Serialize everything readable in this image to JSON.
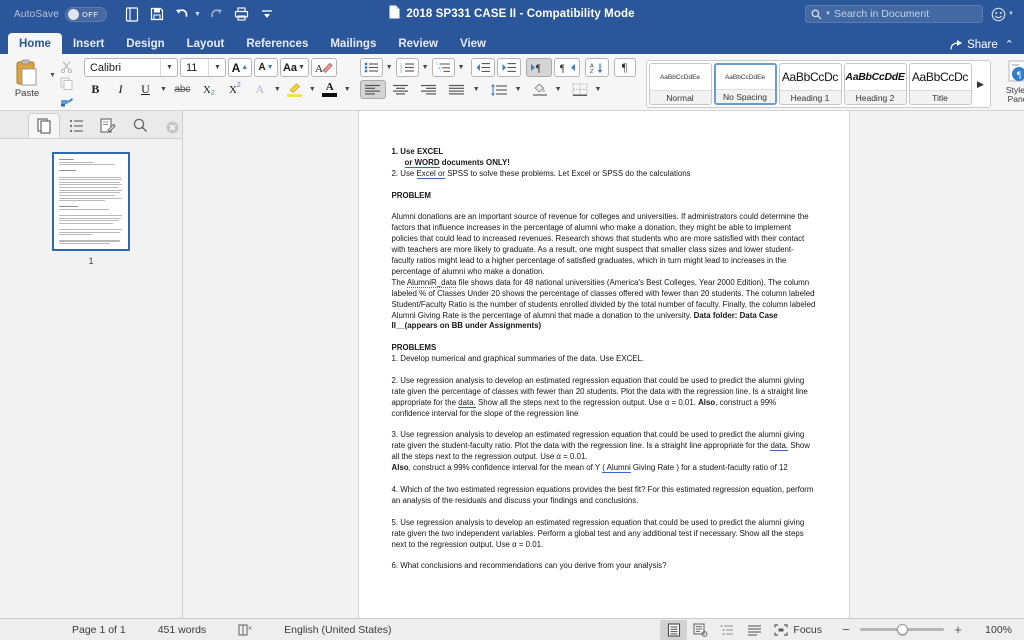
{
  "titlebar": {
    "autosave_label": "AutoSave",
    "autosave_state": "OFF",
    "document_title": "2018 SP331 CASE II  -  Compatibility Mode",
    "quick_access": [
      {
        "name": "new-document-icon",
        "label": "New"
      },
      {
        "name": "save-icon",
        "label": "Save"
      },
      {
        "name": "undo-icon",
        "label": "Undo"
      },
      {
        "name": "redo-icon",
        "label": "Redo"
      },
      {
        "name": "print-icon",
        "label": "Print"
      },
      {
        "name": "customize-toolbar-icon",
        "label": "Customize Quick Access Toolbar"
      }
    ],
    "search_placeholder": "Search in Document",
    "accent_color": "#2b579a"
  },
  "ribbon": {
    "tabs": [
      {
        "label": "Home",
        "active": true
      },
      {
        "label": "Insert",
        "active": false
      },
      {
        "label": "Design",
        "active": false
      },
      {
        "label": "Layout",
        "active": false
      },
      {
        "label": "References",
        "active": false
      },
      {
        "label": "Mailings",
        "active": false
      },
      {
        "label": "Review",
        "active": false
      },
      {
        "label": "View",
        "active": false
      }
    ],
    "share_label": "Share",
    "clipboard": {
      "paste_label": "Paste",
      "cut_label": "Cut",
      "copy_label": "Copy",
      "format_painter_label": "Format Painter"
    },
    "font": {
      "font_name": "Calibri",
      "font_size": "11",
      "grow_font": "A",
      "shrink_font": "A",
      "change_case": "Aa",
      "clear_formatting_label": "Clear Formatting",
      "bold": "B",
      "italic": "I",
      "underline": "U",
      "strikethrough": "abc",
      "subscript_base": "X",
      "subscript_sup": "2",
      "superscript_base": "X",
      "superscript_sup": "2",
      "text_effects": "A",
      "highlight_label": "Text Highlight Color",
      "font_color": "A"
    },
    "paragraph": {
      "bullets_label": "Bullets",
      "numbering_label": "Numbering",
      "multilevel_label": "Multilevel List",
      "decrease_indent_label": "Decrease Indent",
      "increase_indent_label": "Increase Indent",
      "ltr_label": "Left-to-Right Text Direction",
      "rtl_label": "Right-to-Left Text Direction",
      "sort_label": "Sort",
      "show_marks_label": "Show/Hide Paragraph Marks",
      "align_left_label": "Align Left",
      "align_center_label": "Center",
      "align_right_label": "Align Right",
      "justify_label": "Justify",
      "line_spacing_label": "Line and Paragraph Spacing",
      "shading_label": "Shading",
      "borders_label": "Borders"
    },
    "styles": {
      "items": [
        {
          "preview": "AaBbCcDdEe",
          "name": "Normal",
          "selected": false
        },
        {
          "preview": "AaBbCcDdEe",
          "name": "No Spacing",
          "selected": true
        },
        {
          "preview": "AaBbCcDc",
          "name": "Heading 1",
          "selected": false
        },
        {
          "preview": "AaBbCcDdE",
          "name": "Heading 2",
          "selected": false
        },
        {
          "preview": "AaBbCcDc",
          "name": "Title",
          "selected": false
        }
      ],
      "more_label": "More Styles",
      "pane_label_line1": "Styles",
      "pane_label_line2": "Pane"
    }
  },
  "navpane": {
    "tabs": [
      {
        "name": "thumbnails-tab",
        "label": "Thumbnails",
        "active": true
      },
      {
        "name": "document-map-tab",
        "label": "Document Map",
        "active": false
      },
      {
        "name": "reviewing-tab",
        "label": "Reviewing",
        "active": false
      },
      {
        "name": "search-tab",
        "label": "Search",
        "active": false
      }
    ],
    "close_label": "Close",
    "thumbnail_page_number": "1"
  },
  "document": {
    "lines": [
      {
        "type": "bold",
        "text": "1. Use EXCEL"
      },
      {
        "type": "bold-indent-underline",
        "pre": "",
        "underlined": "or  WORD",
        "post": " documents ONLY!"
      },
      {
        "type": "bold-underline-mid",
        "pre": "2. Use ",
        "underlined": "Excel  or",
        "post": " SPSS to solve these problems. Let Excel or SPSS do the calculations"
      },
      {
        "type": "blank"
      },
      {
        "type": "bold",
        "text": "PROBLEM"
      },
      {
        "type": "blank"
      },
      {
        "type": "para",
        "text": "Alumni donations are an important source of revenue for colleges and universities. If administrators could determine the factors that influence increases in the percentage of alumni who make a donation, they might be able to implement policies that could lead to increased revenues. Research shows that students who are more satisfied with their contact with teachers are more likely to graduate. As a result, one might suspect that smaller class sizes and lower student-faculty ratios might lead to a higher percentage of satisfied graduates, which in turn might lead to increases in the percentage of alumni who make a donation."
      },
      {
        "type": "para-spell",
        "pre": "The ",
        "spell": "AlumniR_data",
        "post": " file shows data for 48 national universities (America's Best Colleges, Year 2000 Edition). The column labeled % of Classes Under 20 shows the percentage of classes offered with fewer than 20 students. The column labeled Student/Faculty Ratio is the number of students enrolled divided by the total number of faculty. Finally, the column labeled Alumni Giving Rate is the percentage of alumni that made a donation to the university.",
        "bold_tail": "     Data folder:   Data Case II__(appears on BB under Assignments)"
      },
      {
        "type": "blank"
      },
      {
        "type": "bold",
        "text": "PROBLEMS"
      },
      {
        "type": "para",
        "text": "1. Develop numerical and graphical summaries of the data. Use EXCEL."
      },
      {
        "type": "blank"
      },
      {
        "type": "q2",
        "pre": "2. Use regression analysis to develop an estimated regression equation that could be used to predict the alumni giving rate given the percentage of classes with fewer than 20 students. Plot the data with the regression line. Is a straight line appropriate for the ",
        "grammar": "data.",
        "mid": " Show all the steps next to the regression output. Use α = 0.01.   ",
        "bold": "Also",
        "post": ", construct a 99% confidence interval for the slope of the regression line"
      },
      {
        "type": "blank"
      },
      {
        "type": "q3",
        "pre": "3. Use regression analysis to develop an estimated regression equation that could be used to predict the alumni giving rate given the student-faculty ratio. Plot the data with the regression line. Is a straight line appropriate for the ",
        "grammar": "data.",
        "mid": " Show all the steps next to the regression output. Use α = 0.01.",
        "bold": "Also",
        "post1": ", construct a 99% confidence interval for the mean of Y ",
        "grammar2": "( Alumni",
        "post2": " Giving Rate ) for a student-faculty ratio of 12"
      },
      {
        "type": "blank"
      },
      {
        "type": "para",
        "text": "4. Which of the two estimated regression equations provides the best fit? For this estimated regression equation, perform an analysis of the residuals and discuss your findings and conclusions."
      },
      {
        "type": "blank"
      },
      {
        "type": "para",
        "text": "5. Use regression analysis to develop an estimated regression equation that could be used to predict the alumni giving rate given the two independent variables. Perform a global test and any additional test if necessary. Show all the steps next to the regression output. Use α = 0.01."
      },
      {
        "type": "blank"
      },
      {
        "type": "para",
        "text": "6. What conclusions and recommendations can you derive from your analysis?"
      }
    ]
  },
  "statusbar": {
    "page_label": "Page 1 of 1",
    "word_count": "451 words",
    "proofing_label": "Proofing Errors",
    "language": "English (United States)",
    "views": [
      {
        "name": "print-layout-view",
        "label": "Print Layout",
        "active": true
      },
      {
        "name": "web-layout-view",
        "label": "Web Layout",
        "active": false
      },
      {
        "name": "outline-view",
        "label": "Outline",
        "active": false
      },
      {
        "name": "draft-view",
        "label": "Draft",
        "active": false
      }
    ],
    "focus_label": "Focus",
    "zoom_out": "−",
    "zoom_in": "+",
    "zoom_value": "100%"
  }
}
